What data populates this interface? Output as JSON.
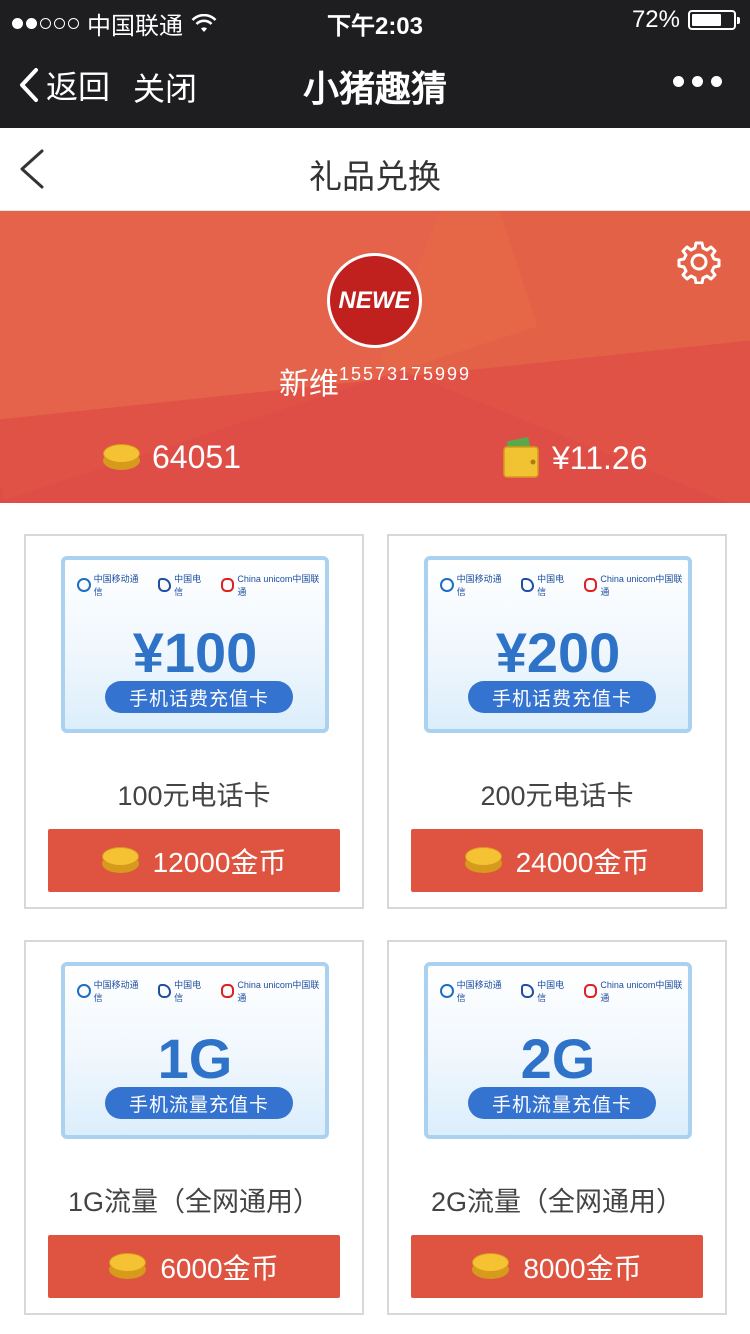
{
  "status_bar": {
    "carrier": "中国联通",
    "time": "下午2:03",
    "battery": "72%",
    "battery_level": 0.72
  },
  "wx_nav": {
    "back_label": "返回",
    "close_label": "关闭",
    "title": "小猪趣猜"
  },
  "page_header": {
    "title": "礼品兑换"
  },
  "profile": {
    "avatar_text": "NEWE",
    "name": "新维",
    "phone": "15573175999",
    "coins": "64051",
    "balance": "¥11.26"
  },
  "products": [
    {
      "value_text": "¥100",
      "pill": "手机话费充值卡",
      "name": "100元电话卡",
      "price": "12000金币"
    },
    {
      "value_text": "¥200",
      "pill": "手机话费充值卡",
      "name": "200元电话卡",
      "price": "24000金币"
    },
    {
      "value_text": "1G",
      "pill": "手机流量充值卡",
      "name": "1G流量（全网通用）",
      "price": "6000金币"
    },
    {
      "value_text": "2G",
      "pill": "手机流量充值卡",
      "name": "2G流量（全网通用）",
      "price": "8000金币"
    }
  ],
  "carriers": {
    "cm": "中国移动通信",
    "ct": "中国电信",
    "cu": "China unicom中国联通"
  },
  "colors": {
    "banner": "#e0544a",
    "button": "#df5440",
    "card_value": "#2e73c8"
  }
}
